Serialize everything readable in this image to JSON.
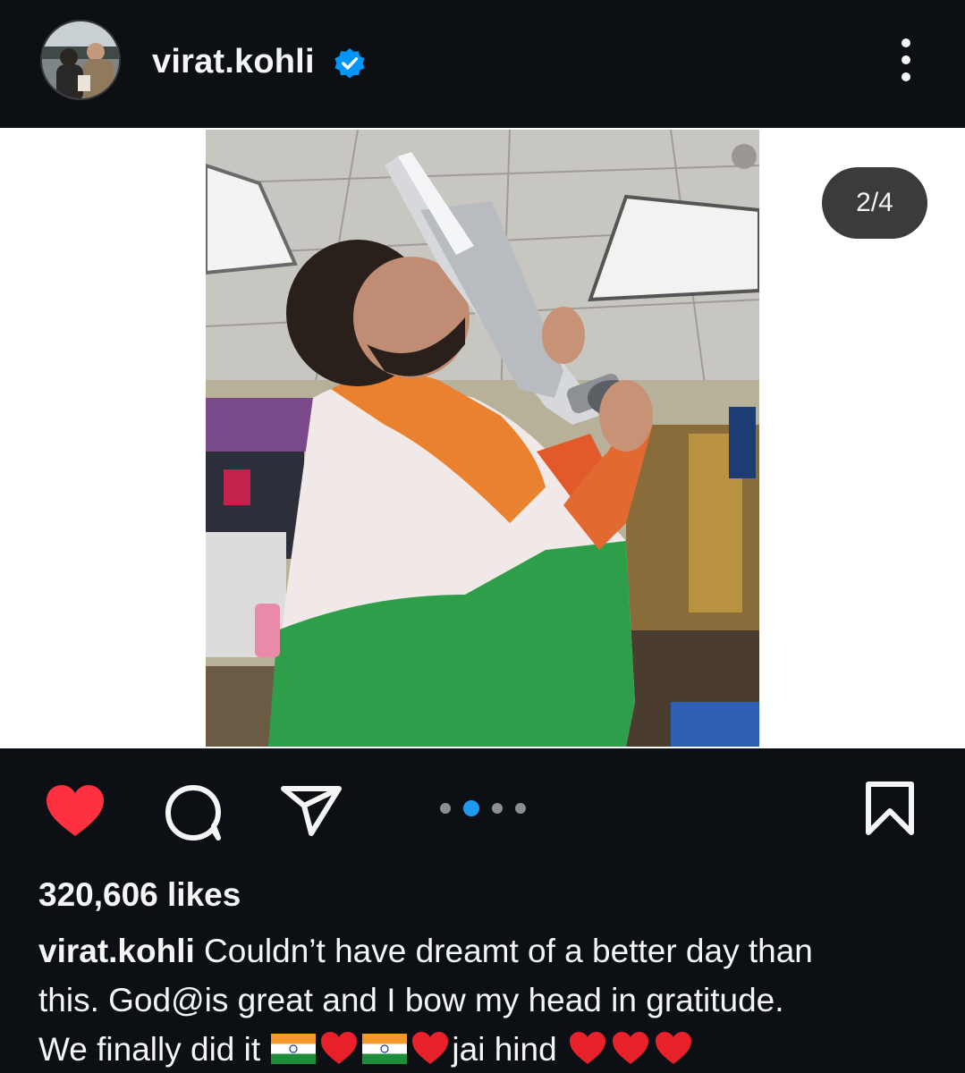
{
  "header": {
    "username": "virat.kohli",
    "verified_icon": "verified-badge-icon",
    "more_icon": "more-options-icon"
  },
  "media": {
    "counter": "2/4",
    "carousel_total": 4,
    "carousel_active": 2
  },
  "actions": {
    "like_icon": "heart-icon",
    "comment_icon": "comment-icon",
    "share_icon": "send-icon",
    "save_icon": "bookmark-icon"
  },
  "post": {
    "likes": "320,606 likes",
    "caption_user": "virat.kohli",
    "caption_line1": " Couldn’t have dreamt of a better day than",
    "caption_line2": "this. God@is great and I bow my head in gratitude.",
    "caption_line3_a": "We finally did it ",
    "caption_line3_b": "jai hind "
  },
  "colors": {
    "background": "#0c1014",
    "like_red": "#ff3040",
    "verified_blue": "#0095f6",
    "active_dot": "#1d9bf0"
  }
}
